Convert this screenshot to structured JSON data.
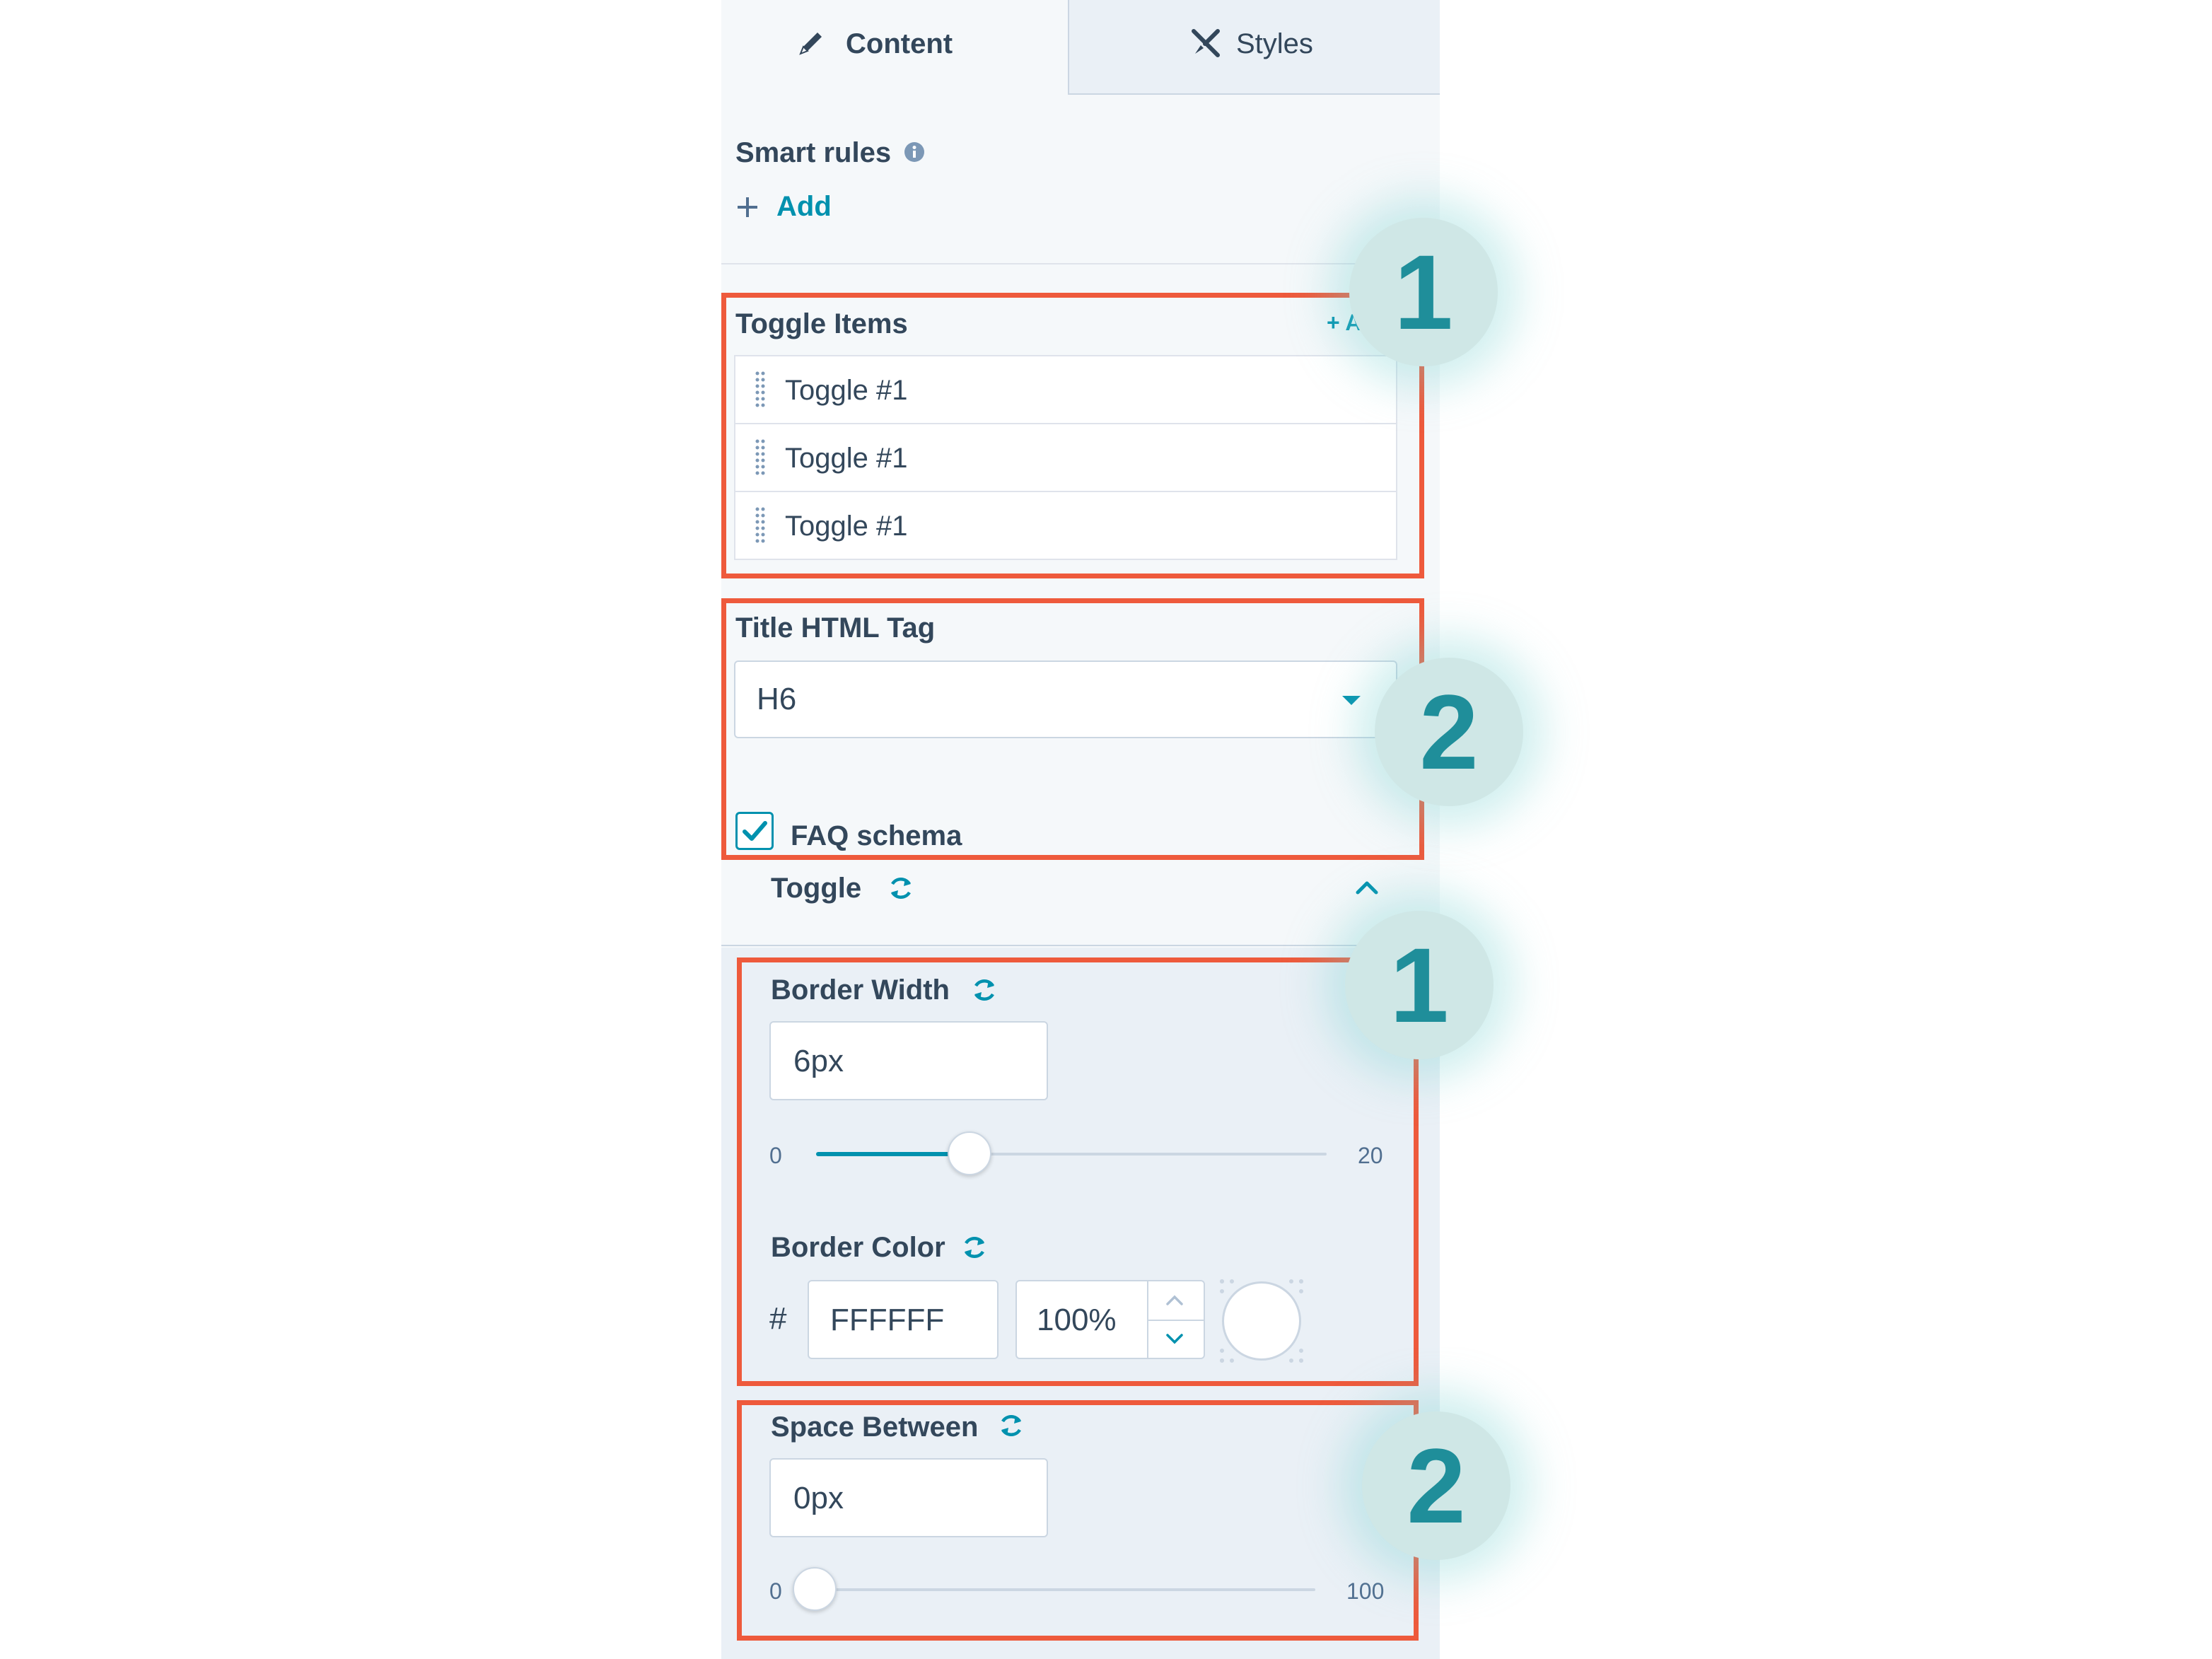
{
  "tabs": [
    {
      "label": "Content",
      "icon": "pencil-icon",
      "active": true
    },
    {
      "label": "Styles",
      "icon": "brush-icon",
      "active": false
    }
  ],
  "smart_rules": {
    "label": "Smart rules",
    "add_label": "Add"
  },
  "toggle_items": {
    "label": "Toggle Items",
    "add_label": "+ A",
    "items": [
      "Toggle #1",
      "Toggle #1",
      "Toggle #1"
    ]
  },
  "title_tag": {
    "label": "Title HTML Tag",
    "value": "H6"
  },
  "faq_schema": {
    "label": "FAQ schema",
    "checked": true
  },
  "toggle_section": {
    "label": "Toggle",
    "expanded": true
  },
  "border_width": {
    "label": "Border Width",
    "value": "6px",
    "min": "0",
    "max": "20",
    "level": 6
  },
  "border_color": {
    "label": "Border Color",
    "hash": "#",
    "hex": "FFFFFF",
    "opacity": "100%",
    "swatch": "#FFFFFF"
  },
  "space_between": {
    "label": "Space Between",
    "value": "0px",
    "min": "0",
    "max": "100",
    "level": 0
  },
  "badges": [
    "1",
    "2",
    "1",
    "2"
  ],
  "colors": {
    "accent": "#0091ae",
    "highlight": "#ee5a3c",
    "badge_bg": "#cfe7e6",
    "badge_text": "#1f8e9a"
  }
}
